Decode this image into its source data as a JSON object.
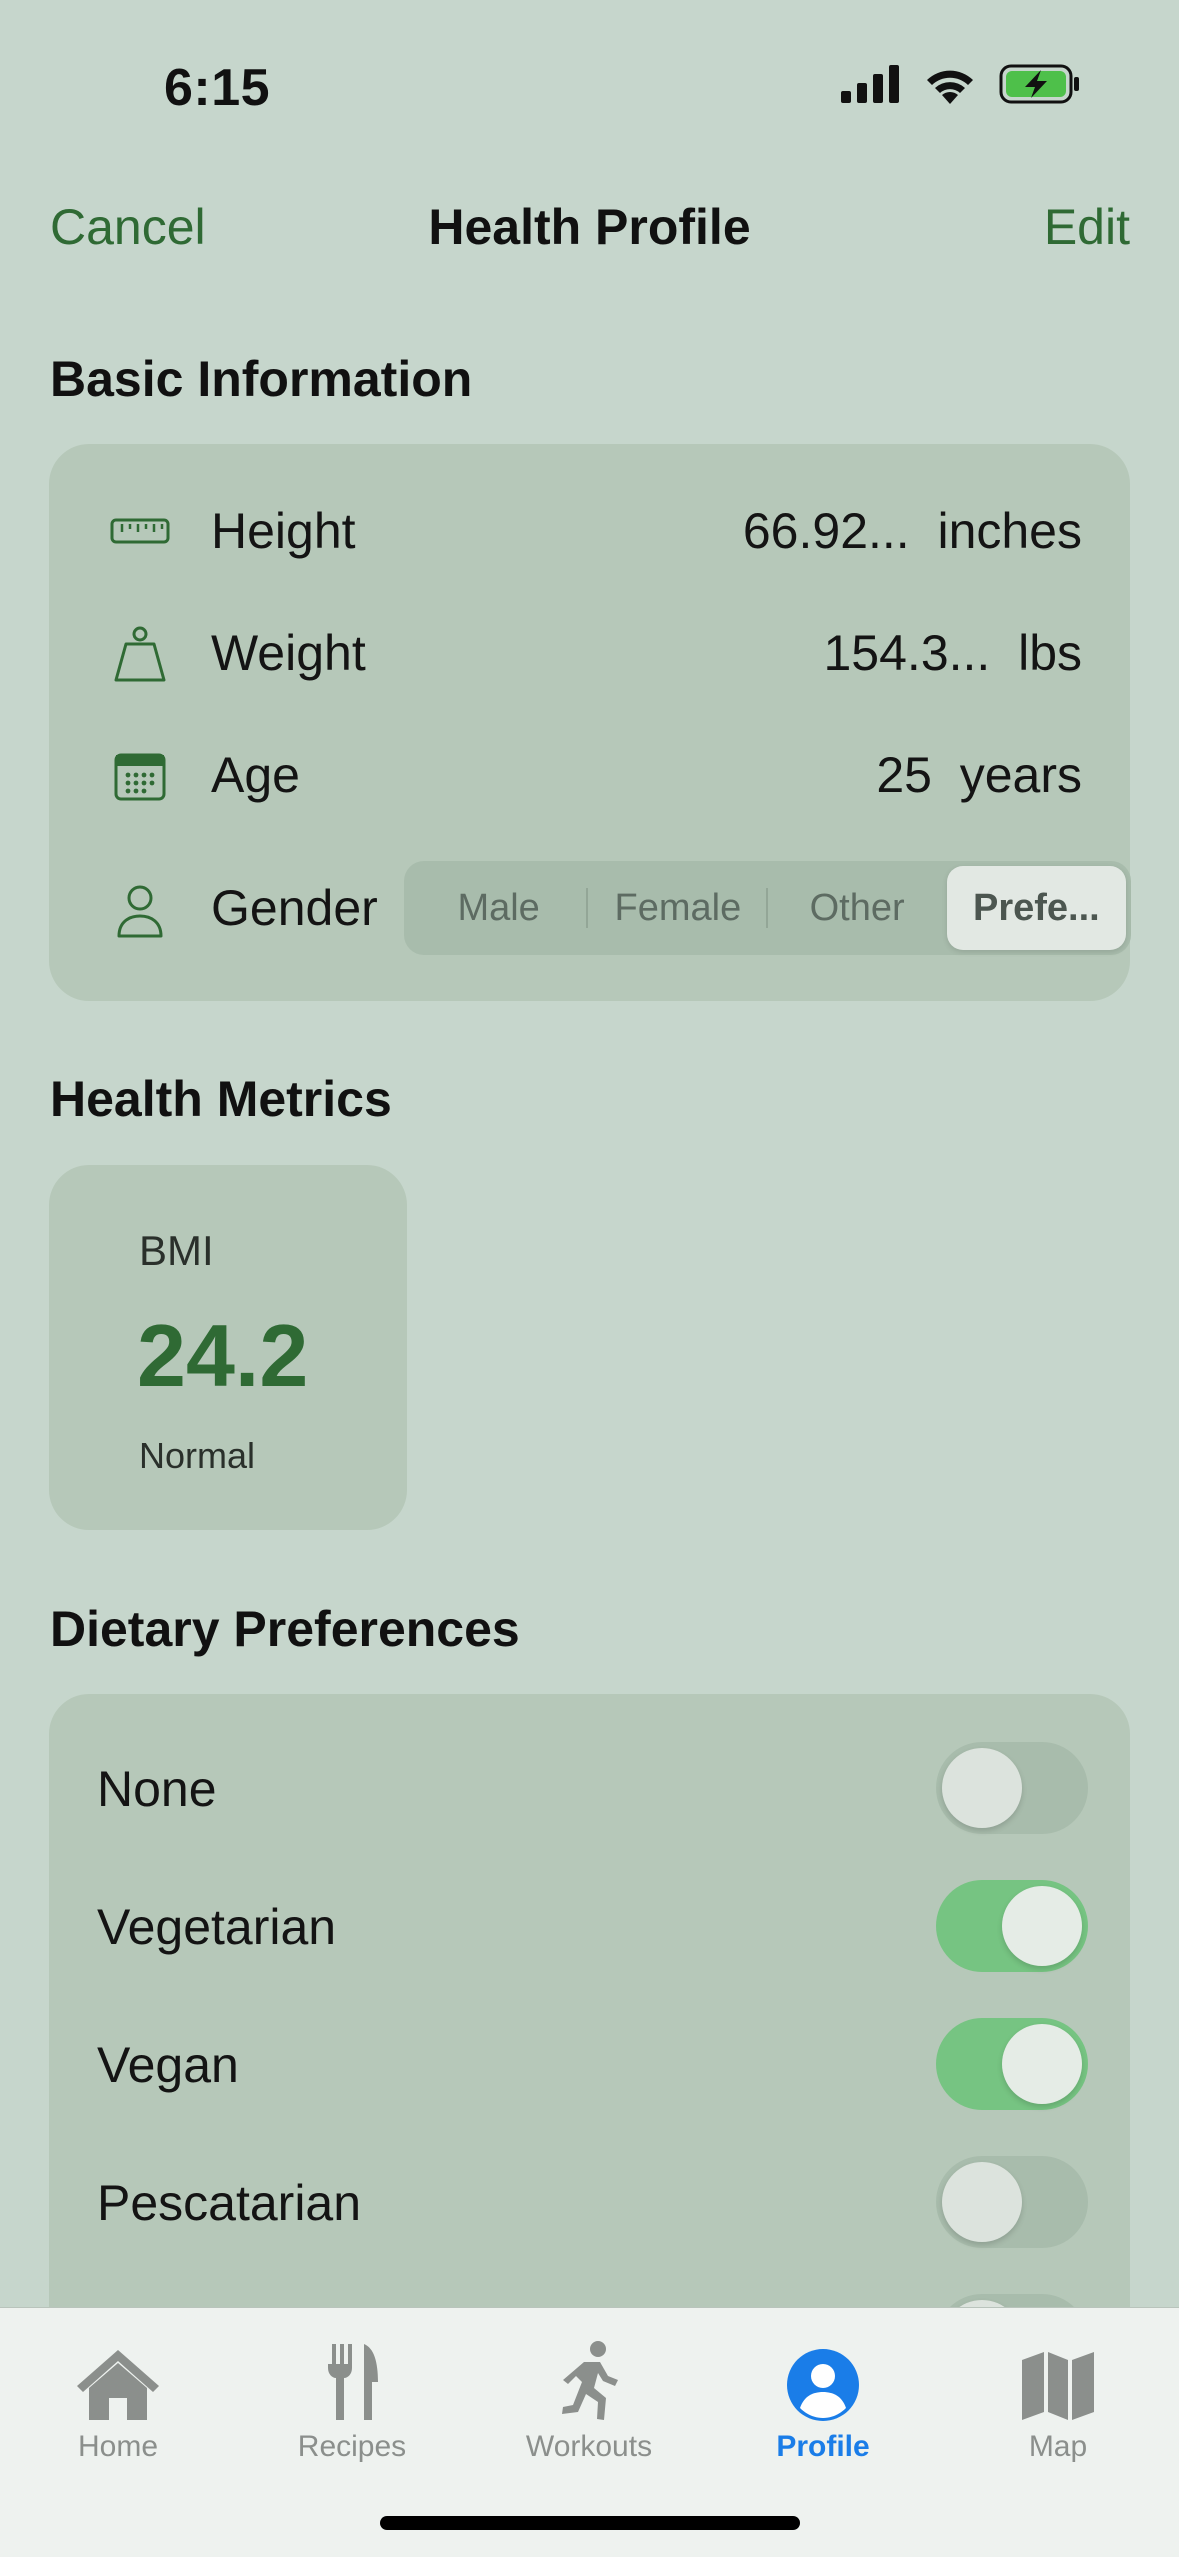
{
  "status_bar": {
    "time": "6:15"
  },
  "nav": {
    "cancel": "Cancel",
    "title": "Health Profile",
    "edit": "Edit"
  },
  "basic_info": {
    "title": "Basic Information",
    "rows": [
      {
        "icon": "ruler-icon",
        "label": "Height",
        "value": "66.92...  inches"
      },
      {
        "icon": "weight-icon",
        "label": "Weight",
        "value": "154.3...  lbs"
      },
      {
        "icon": "calendar-icon",
        "label": "Age",
        "value": "25  years"
      }
    ],
    "gender": {
      "label": "Gender",
      "options": [
        "Male",
        "Female",
        "Other",
        "Prefe..."
      ],
      "selected": "Prefe..."
    }
  },
  "health_metrics": {
    "title": "Health Metrics",
    "bmi": {
      "label": "BMI",
      "value": "24.2",
      "status": "Normal"
    }
  },
  "dietary": {
    "title": "Dietary Preferences",
    "items": [
      {
        "label": "None",
        "on": false
      },
      {
        "label": "Vegetarian",
        "on": true
      },
      {
        "label": "Vegan",
        "on": true
      },
      {
        "label": "Pescatarian",
        "on": false
      }
    ]
  },
  "tabbar": {
    "items": [
      {
        "label": "Home",
        "icon": "house-icon",
        "active": false
      },
      {
        "label": "Recipes",
        "icon": "fork-knife-icon",
        "active": false
      },
      {
        "label": "Workouts",
        "icon": "running-figure-icon",
        "active": false
      },
      {
        "label": "Profile",
        "icon": "person-circle-icon",
        "active": true
      },
      {
        "label": "Map",
        "icon": "map-icon",
        "active": false
      }
    ]
  },
  "colors": {
    "accent_green": "#2f6a34",
    "toggle_on": "#76c482",
    "tab_active": "#1a7de8",
    "background": "#c6d6cc",
    "card": "#b6c8b9"
  }
}
